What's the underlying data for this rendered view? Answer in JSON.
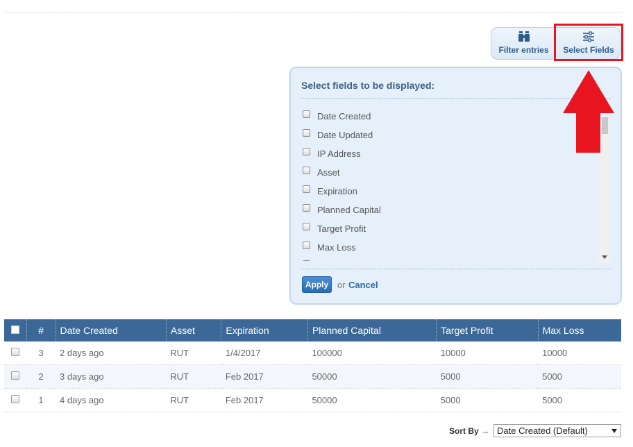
{
  "toolbar": {
    "filter_label": "Filter entries",
    "select_label": "Select Fields",
    "filter_icon": "binoculars-icon",
    "select_icon": "sliders-icon"
  },
  "panel": {
    "title": "Select fields to be displayed:",
    "fields": [
      {
        "label": "Date Created",
        "checked": false
      },
      {
        "label": "Date Updated",
        "checked": false
      },
      {
        "label": "IP Address",
        "checked": false
      },
      {
        "label": "Asset",
        "checked": false
      },
      {
        "label": "Expiration",
        "checked": false
      },
      {
        "label": "Planned Capital",
        "checked": false
      },
      {
        "label": "Target Profit",
        "checked": false
      },
      {
        "label": "Max Loss",
        "checked": false
      }
    ],
    "apply_label": "Apply",
    "or_text": "or",
    "cancel_label": "Cancel"
  },
  "annotation": {
    "color": "#e8141f"
  },
  "table": {
    "headers": [
      "#",
      "Date Created",
      "Asset",
      "Expiration",
      "Planned Capital",
      "Target Profit",
      "Max Loss"
    ],
    "rows": [
      {
        "num": "3",
        "date_created": "2 days ago",
        "asset": "RUT",
        "expiration": "1/4/2017",
        "planned_capital": "100000",
        "target_profit": "10000",
        "max_loss": "10000"
      },
      {
        "num": "2",
        "date_created": "3 days ago",
        "asset": "RUT",
        "expiration": "Feb 2017",
        "planned_capital": "50000",
        "target_profit": "5000",
        "max_loss": "5000"
      },
      {
        "num": "1",
        "date_created": "4 days ago",
        "asset": "RUT",
        "expiration": "Feb 2017",
        "planned_capital": "50000",
        "target_profit": "5000",
        "max_loss": "5000"
      }
    ]
  },
  "sort": {
    "label": "Sort By",
    "arrow": "→",
    "selected": "Date Created (Default)"
  },
  "colors": {
    "header_bg": "#3c6897",
    "accent": "#2f5d8a",
    "apply_bg": "#2a6cb5"
  }
}
